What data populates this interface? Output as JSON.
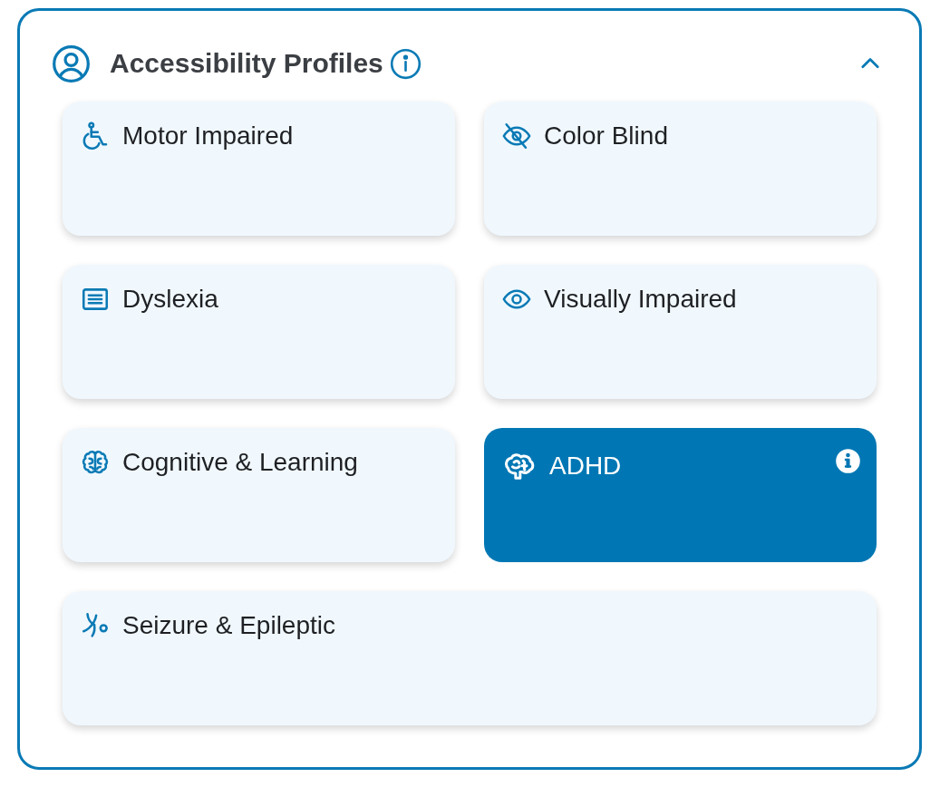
{
  "panel": {
    "title": "Accessibility Profiles",
    "expanded": true
  },
  "profiles": [
    {
      "label": "Motor Impaired",
      "kind": "wheelchair",
      "selected": false
    },
    {
      "label": "Color Blind",
      "kind": "eye-slash",
      "selected": false
    },
    {
      "label": "Dyslexia",
      "kind": "text-lines",
      "selected": false
    },
    {
      "label": "Visually Impaired",
      "kind": "eye",
      "selected": false
    },
    {
      "label": "Cognitive & Learning",
      "kind": "brain",
      "selected": false
    },
    {
      "label": "ADHD",
      "kind": "brain-side",
      "selected": true
    },
    {
      "label": "Seizure & Epileptic",
      "kind": "nerve",
      "selected": false
    }
  ]
}
